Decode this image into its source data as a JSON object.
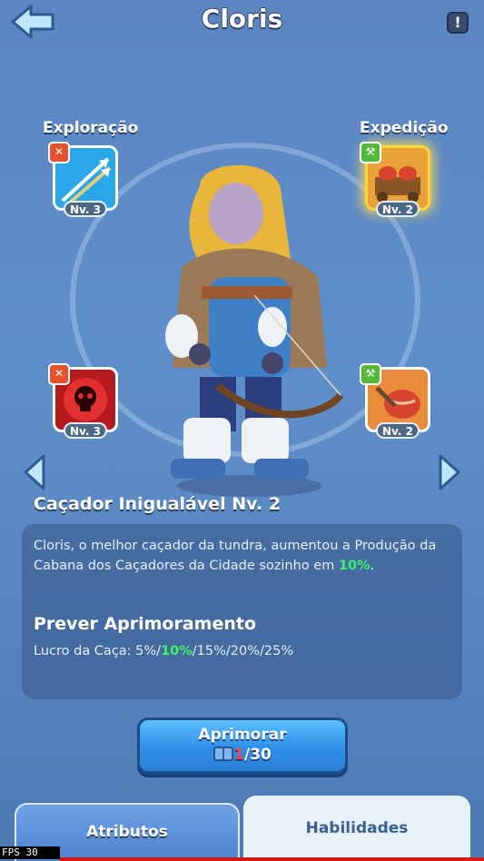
{
  "header": {
    "title": "Cloris",
    "info_glyph": "!"
  },
  "skills": {
    "exploration_label": "Exploração",
    "expedition_label": "Expedição",
    "top_left_level": "Nv. 3",
    "top_right_level": "Nv. 2",
    "bottom_left_level": "Nv. 3",
    "bottom_right_level": "Nv. 2",
    "top_left_icon": "arrows-icon",
    "top_right_icon": "meat-cart-icon",
    "bottom_left_icon": "skull-icon",
    "bottom_right_icon": "meat-icon"
  },
  "selected_skill": {
    "name": "Caçador Inigualável Nv. 2",
    "description_pre": "Cloris, o melhor caçador da tundra, aumentou a Produção da Cabana dos Caçadores da Cidade sozinho em ",
    "description_highlight": "10%",
    "description_post": "."
  },
  "preview": {
    "title": "Prever Aprimoramento",
    "line_pre": "Lucro da Caça: 5%/",
    "line_highlight": "10%",
    "line_post": "/15%/20%/25%"
  },
  "upgrade": {
    "label": "Aprimorar",
    "have": "1",
    "need": "/30"
  },
  "tabs": {
    "left": "Atributos",
    "right": "Habilidades"
  },
  "fps": "FPS  30",
  "colors": {
    "highlight": "#3ef068",
    "cost_insufficient": "#ff4646",
    "accent_gold": "#ffd43a"
  }
}
